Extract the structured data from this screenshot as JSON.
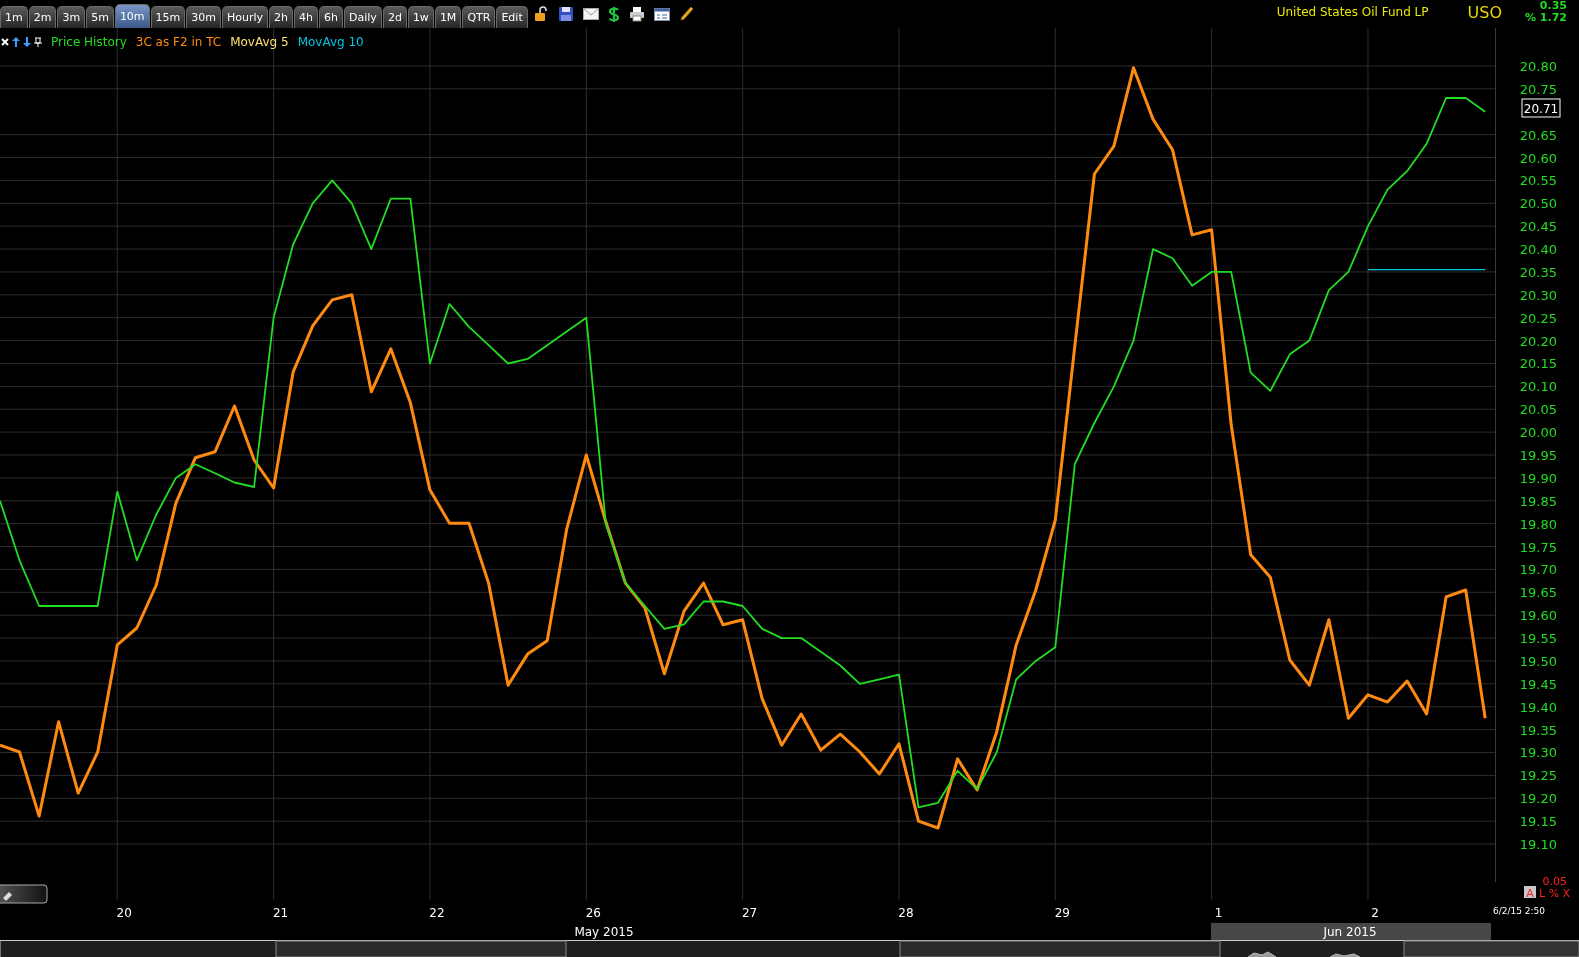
{
  "toolbar": {
    "tabs": [
      {
        "label": "1m",
        "selected": false
      },
      {
        "label": "2m",
        "selected": false
      },
      {
        "label": "3m",
        "selected": false
      },
      {
        "label": "5m",
        "selected": false
      },
      {
        "label": "10m",
        "selected": true
      },
      {
        "label": "15m",
        "selected": false
      },
      {
        "label": "30m",
        "selected": false
      },
      {
        "label": "Hourly",
        "selected": false
      },
      {
        "label": "2h",
        "selected": false
      },
      {
        "label": "4h",
        "selected": false
      },
      {
        "label": "6h",
        "selected": false
      },
      {
        "label": "Daily",
        "selected": false
      },
      {
        "label": "2d",
        "selected": false
      },
      {
        "label": "1w",
        "selected": false
      },
      {
        "label": "1M",
        "selected": false
      },
      {
        "label": "QTR",
        "selected": false
      }
    ],
    "edit_button": "Edit"
  },
  "header": {
    "title": "United States Oil Fund LP",
    "symbol": "USO",
    "change": "0.35",
    "change_percent": "% 1.72"
  },
  "legend": [
    {
      "label": "MovAvg 5",
      "color": "#ffe070"
    }
  ],
  "chart_data": {
    "type": "line",
    "categories": [
      null,
      null,
      null,
      null,
      null,
      null,
      "20",
      null,
      null,
      null,
      null,
      null,
      null,
      null,
      "21",
      null,
      null,
      null,
      null,
      null,
      null,
      null,
      "22",
      null,
      null,
      null,
      null,
      null,
      null,
      null,
      "26",
      null,
      null,
      null,
      null,
      null,
      null,
      null,
      "27",
      null,
      null,
      null,
      null,
      null,
      null,
      null,
      "28",
      null,
      null,
      null,
      null,
      null,
      null,
      null,
      "29",
      null,
      null,
      null,
      null,
      null,
      null,
      null,
      "1",
      null,
      null,
      null,
      null,
      null,
      null,
      null,
      "2",
      null,
      null,
      null,
      null,
      null,
      null
    ],
    "series": [
      {
        "name": "Price History",
        "color": "#22dd22",
        "values": [
          19.85,
          19.72,
          19.62,
          19.62,
          19.62,
          19.62,
          19.87,
          19.72,
          19.82,
          19.9,
          19.93,
          19.91,
          19.89,
          19.88,
          20.25,
          20.41,
          20.5,
          20.55,
          20.5,
          20.4,
          20.51,
          20.51,
          20.15,
          20.28,
          20.23,
          20.19,
          20.15,
          20.16,
          20.19,
          20.22,
          20.25,
          19.8,
          19.67,
          19.62,
          19.57,
          19.58,
          19.63,
          19.63,
          19.62,
          19.57,
          19.55,
          19.55,
          19.52,
          19.49,
          19.45,
          19.46,
          19.47,
          19.18,
          19.19,
          19.26,
          19.22,
          19.3,
          19.46,
          19.5,
          19.53,
          19.93,
          20.02,
          20.1,
          20.2,
          20.4,
          20.38,
          20.32,
          20.35,
          20.35,
          20.13,
          20.09,
          20.17,
          20.2,
          20.31,
          20.35,
          20.45,
          20.53,
          20.57,
          20.63,
          20.73,
          20.73,
          20.7
        ]
      },
      {
        "name": "3C as F2 in TC",
        "color": "#ff8a10",
        "values": [
          19.316,
          19.301,
          19.161,
          19.367,
          19.211,
          19.301,
          19.535,
          19.572,
          19.666,
          19.845,
          19.944,
          19.957,
          20.057,
          19.939,
          19.878,
          20.131,
          20.232,
          20.289,
          20.3,
          20.088,
          20.182,
          20.064,
          19.874,
          19.801,
          19.801,
          19.67,
          19.447,
          19.515,
          19.544,
          19.788,
          19.95,
          19.804,
          19.67,
          19.616,
          19.472,
          19.609,
          19.67,
          19.579,
          19.59,
          19.417,
          19.316,
          19.384,
          19.305,
          19.34,
          19.301,
          19.253,
          19.319,
          19.15,
          19.135,
          19.286,
          19.218,
          19.345,
          19.535,
          19.655,
          19.808,
          20.188,
          20.564,
          20.625,
          20.796,
          20.684,
          20.617,
          20.431,
          20.442,
          20.016,
          19.732,
          19.683,
          19.502,
          19.447,
          19.59,
          19.375,
          19.426,
          19.41,
          19.456,
          19.384,
          19.64,
          19.655,
          19.375
        ]
      },
      {
        "name": "MovAvg 10",
        "color": "#00c8e0",
        "values": [
          null,
          null,
          null,
          null,
          null,
          null,
          null,
          null,
          null,
          null,
          null,
          null,
          null,
          null,
          null,
          null,
          null,
          null,
          null,
          null,
          null,
          null,
          null,
          null,
          null,
          null,
          null,
          null,
          null,
          null,
          null,
          null,
          null,
          null,
          null,
          null,
          null,
          null,
          null,
          null,
          null,
          null,
          null,
          null,
          null,
          null,
          null,
          null,
          null,
          null,
          null,
          null,
          null,
          null,
          null,
          null,
          null,
          null,
          null,
          null,
          null,
          null,
          null,
          null,
          null,
          null,
          null,
          null,
          null,
          null,
          20.355,
          20.355,
          20.355,
          20.355,
          20.355,
          20.355,
          20.355
        ]
      }
    ],
    "grid": true,
    "ylim": [
      19.017,
      20.883
    ],
    "yticks": [
      {
        "value": 19.1,
        "label": "19.10"
      },
      {
        "value": 19.15,
        "label": "19.15"
      },
      {
        "value": 19.2,
        "label": "19.20"
      },
      {
        "value": 19.25,
        "label": "19.25"
      },
      {
        "value": 19.3,
        "label": "19.30"
      },
      {
        "value": 19.35,
        "label": "19.35"
      },
      {
        "value": 19.4,
        "label": "19.40"
      },
      {
        "value": 19.45,
        "label": "19.45"
      },
      {
        "value": 19.5,
        "label": "19.50"
      },
      {
        "value": 19.55,
        "label": "19.55"
      },
      {
        "value": 19.6,
        "label": "19.60"
      },
      {
        "value": 19.65,
        "label": "19.65"
      },
      {
        "value": 19.7,
        "label": "19.70"
      },
      {
        "value": 19.75,
        "label": "19.75"
      },
      {
        "value": 19.8,
        "label": "19.80"
      },
      {
        "value": 19.85,
        "label": "19.85"
      },
      {
        "value": 19.9,
        "label": "19.90"
      },
      {
        "value": 19.95,
        "label": "19.95"
      },
      {
        "value": 20.0,
        "label": "20.00"
      },
      {
        "value": 20.05,
        "label": "20.05"
      },
      {
        "value": 20.1,
        "label": "20.10"
      },
      {
        "value": 20.15,
        "label": "20.15"
      },
      {
        "value": 20.2,
        "label": "20.20"
      },
      {
        "value": 20.25,
        "label": "20.25"
      },
      {
        "value": 20.3,
        "label": "20.30"
      },
      {
        "value": 20.35,
        "label": "20.35"
      },
      {
        "value": 20.4,
        "label": "20.40"
      },
      {
        "value": 20.45,
        "label": "20.45"
      },
      {
        "value": 20.5,
        "label": "20.50"
      },
      {
        "value": 20.55,
        "label": "20.55"
      },
      {
        "value": 20.6,
        "label": "20.60"
      },
      {
        "value": 20.65,
        "label": "20.65"
      },
      {
        "value": 20.75,
        "label": "20.75"
      },
      {
        "value": 20.8,
        "label": "20.80"
      }
    ]
  },
  "last_price": "20.71",
  "indicator_reading": "0.05",
  "indicator_button": "A",
  "indicator_options": "L % X",
  "timestamp": "6/2/15 2:50",
  "months": [
    {
      "label": "May 2015",
      "selected": false
    },
    {
      "label": "Jun 2015",
      "selected": true
    }
  ]
}
